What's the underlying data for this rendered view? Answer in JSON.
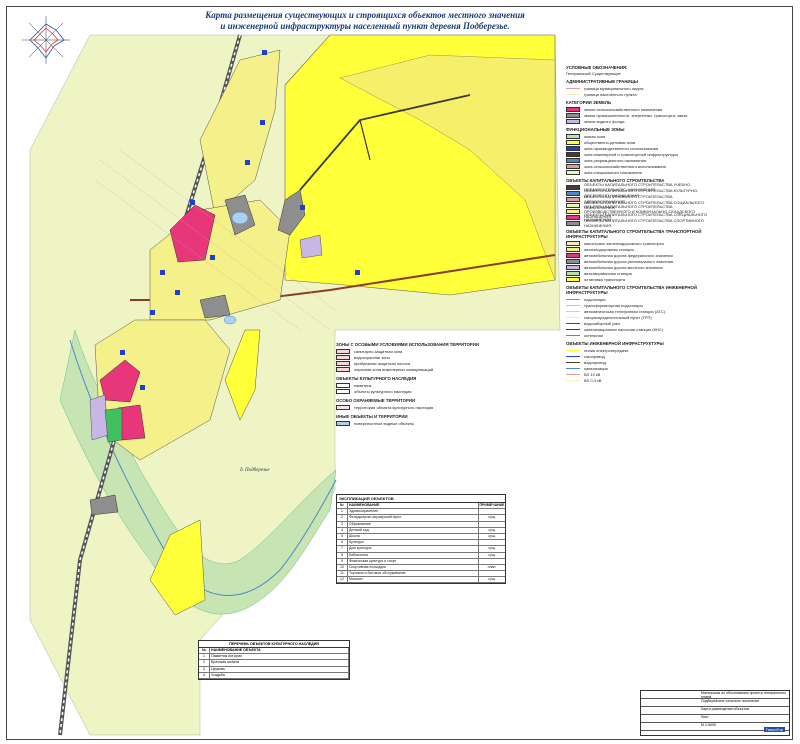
{
  "title": {
    "line1": "Карта размещения существующих и строящихся объектов местного значения",
    "line2": "и инженерной инфраструктуры населенный пункт деревня Подберезье."
  },
  "map": {
    "village_label": "д. Подберезье",
    "object_markers": [
      "1",
      "2",
      "3",
      "4",
      "5",
      "6",
      "7",
      "8",
      "9",
      "10",
      "11",
      "12"
    ]
  },
  "legend": {
    "header": "УСЛОВНЫЕ ОБОЗНАЧЕНИЯ:",
    "subheader": "Генеральный Существующее",
    "sections": [
      {
        "title": "АДМИНИСТРАТИВНЫЕ ГРАНИЦЫ",
        "items": [
          "граница муниципального округа",
          "граница населенного пункта"
        ]
      },
      {
        "title": "КАТЕГОРИИ ЗЕМЕЛЬ",
        "items": [
          "земли сельскохозяйственного назначения",
          "земли промышленности, энергетики, транспорта, связи",
          "земли водного фонда"
        ]
      },
      {
        "title": "ФУНКЦИОНАЛЬНЫЕ ЗОНЫ",
        "items": [
          "жилая зона",
          "общественно-деловая зона",
          "зона производственного использования",
          "зона инженерной и транспортной инфраструктуры",
          "зона рекреационного назначения",
          "зона сельскохозяйственного использования",
          "зона специального назначения"
        ]
      },
      {
        "title": "ОБЪЕКТЫ КАПИТАЛЬНОГО СТРОИТЕЛЬСТВА",
        "items": [
          "ОБЪЕКТЫ КАПИТАЛЬНОГО СТРОИТЕЛЬСТВА УЧЕБНО-ОБРАЗОВАТЕЛЬНОГО НАЗНАЧЕНИЯ",
          "ОБЪЕКТЫ КАПИТАЛЬНОГО СТРОИТЕЛЬСТВА КУЛЬТУРНО-ДОСУГОВОГО НАЗНАЧЕНИЯ",
          "ОБЪЕКТЫ КАПИТАЛЬНОГО СТРОИТЕЛЬСТВА ЗДРАВООХРАНЕНИЯ",
          "ОБЪЕКТЫ КАПИТАЛЬНОГО СТРОИТЕЛЬСТВА СОЦИАЛЬНОГО ОБЕСПЕЧЕНИЯ",
          "ОБЪЕКТЫ КАПИТАЛЬНОГО СТРОИТЕЛЬСТВА ПРОИЗВОДСТВЕННОГО И КОММУНАЛЬНО-СКЛАДСКОГО НАЗНАЧЕНИЯ",
          "ОБЪЕКТЫ КАПИТАЛЬНОГО СТРОИТЕЛЬСТВА СПЕЦИАЛЬНОГО НАЗНАЧЕНИЯ",
          "ОБЪЕКТЫ КАПИТАЛЬНОГО СТРОИТЕЛЬСТВА СПОРТИВНОГО НАЗНАЧЕНИЯ"
        ]
      },
      {
        "title": "ОБЪЕКТЫ КАПИТАЛЬНОГО СТРОИТЕЛЬСТВА ТРАНСПОРТНОЙ ИНФРАСТРУКТУРЫ",
        "items": [
          "магистраль железнодорожного транспорта",
          "железнодорожная станция",
          "автомобильная дорога федерального значения",
          "автомобильная дорога регионального значения",
          "автомобильная дорога местного значения",
          "автозаправочная станция",
          "остановка транспорта"
        ]
      },
      {
        "title": "ОБЪЕКТЫ КАПИТАЛЬНОГО СТРОИТЕЛЬСТВА ИНЖЕНЕРНОЙ ИНФРАСТРУКТУРЫ",
        "items": [
          "подстанция",
          "трансформаторная подстанция",
          "автоматическая телефонная станция (АТС)",
          "газораспределительный пункт (ГРП)",
          "водозаборный узел",
          "канализационная насосная станция (КНС)",
          "котельная"
        ]
      },
      {
        "title": "ОБЪЕКТЫ ИНЖЕНЕРНОЙ ИНФРАСТРУКТУРЫ",
        "items": [
          "линия электропередачи",
          "газопровод",
          "водопровод",
          "канализация",
          "ВЛ 10 кВ",
          "ВЛ 0,4 кВ"
        ]
      }
    ]
  },
  "zones_legend": {
    "title": "ЗОНЫ С ОСОБЫМИ УСЛОВИЯМИ ИСПОЛЬЗОВАНИЯ ТЕРРИТОРИИ",
    "items": [
      "санитарно-защитная зона",
      "водоохранная зона",
      "прибрежная защитная полоса",
      "охранная зона инженерных коммуникаций"
    ],
    "heritage_title": "ОБЪЕКТЫ КУЛЬТУРНОГО НАСЛЕДИЯ",
    "heritage_items": [
      "памятник",
      "объекты культурного наследия"
    ],
    "protected_title": "ОСОБО ОХРАНЯЕМЫЕ ТЕРРИТОРИИ",
    "protected_items": [
      "территория объекта культурного наследия"
    ],
    "other_title": "ИНЫЕ ОБЪЕКТЫ И ТЕРРИТОРИИ",
    "other_items": [
      "поверхностные водные объекты"
    ]
  },
  "objects_table": {
    "title": "ЭКСПЛИКАЦИЯ ОБЪЕКТОВ",
    "header": [
      "№",
      "НАИМЕНОВАНИЕ",
      "ПРИМЕЧАНИЕ"
    ],
    "rows": [
      [
        "1",
        "Здравоохранение",
        ""
      ],
      [
        "2",
        "Фельдшерско-акушерский пункт",
        "сущ."
      ],
      [
        "3",
        "Образование",
        ""
      ],
      [
        "4",
        "Детский сад",
        "сущ."
      ],
      [
        "5",
        "Школа",
        "сущ."
      ],
      [
        "6",
        "Культура",
        ""
      ],
      [
        "7",
        "Дом культуры",
        "сущ."
      ],
      [
        "8",
        "Библиотека",
        "сущ."
      ],
      [
        "9",
        "Физическая культура и спорт",
        ""
      ],
      [
        "10",
        "Спортивная площадка",
        "план."
      ],
      [
        "11",
        "Торговля и бытовое обслуживание",
        ""
      ],
      [
        "12",
        "Магазин",
        "сущ."
      ]
    ]
  },
  "culture_table": {
    "title": "ПЕРЕЧЕНЬ ОБЪЕКТОВ КУЛЬТУРНОГО НАСЛЕДИЯ",
    "header": [
      "№",
      "НАИМЕНОВАНИЕ ОБЪЕКТА"
    ],
    "rows": [
      [
        "1",
        "Памятник истории"
      ],
      [
        "2",
        "Братская могила"
      ],
      [
        "3",
        "Церковь"
      ],
      [
        "4",
        "Усадьба"
      ]
    ]
  },
  "stamp": {
    "rows": [
      "Материалы по обоснованию проекта генерального плана",
      "Подберезское сельское поселение",
      "Карта размещения объектов",
      "Лист",
      "М 1:5000"
    ],
    "badge": "ГипроГор"
  },
  "colors": {
    "residential": "#f4f08a",
    "public": "#e8367a",
    "production": "#7d7d7d",
    "agricultural": "#eef2b6",
    "recreation": "#b7e3a9",
    "special": "#ffff00",
    "water": "#a9d2ef",
    "road": "#4a3a32",
    "railway": "#6a6a6a",
    "marker": "#1f3fcc"
  }
}
